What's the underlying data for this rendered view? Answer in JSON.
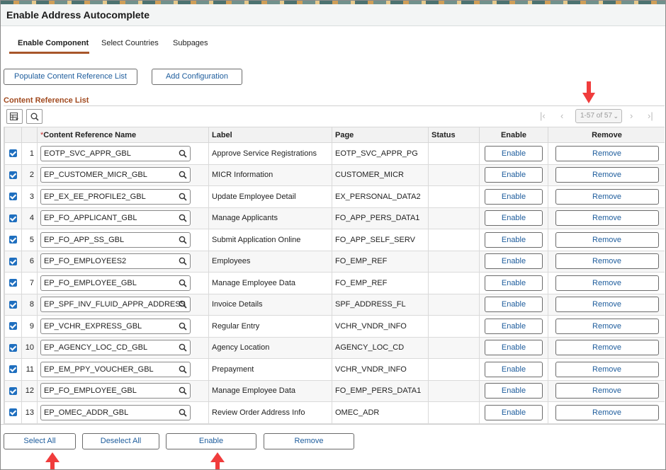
{
  "page": {
    "title": "Enable Address Autocomplete"
  },
  "tabs": [
    {
      "label": "Enable Component",
      "active": true
    },
    {
      "label": "Select Countries",
      "active": false
    },
    {
      "label": "Subpages",
      "active": false
    }
  ],
  "actions": {
    "populate_label": "Populate Content Reference List",
    "add_config_label": "Add Configuration"
  },
  "section": {
    "title": "Content Reference List"
  },
  "toolbar": {
    "grid_icon": "grid-options-icon",
    "search_icon": "search-icon",
    "pager_text": "1-57 of 57"
  },
  "grid": {
    "headers": {
      "name": "Content Reference Name",
      "required_mark": "*",
      "label": "Label",
      "page": "Page",
      "status": "Status",
      "enable": "Enable",
      "remove": "Remove"
    },
    "rows": [
      {
        "num": "1",
        "name": "EOTP_SVC_APPR_GBL",
        "label": "Approve Service Registrations",
        "page": "EOTP_SVC_APPR_PG",
        "status": "",
        "enable": "Enable",
        "remove": "Remove"
      },
      {
        "num": "2",
        "name": "EP_CUSTOMER_MICR_GBL",
        "label": "MICR Information",
        "page": "CUSTOMER_MICR",
        "status": "",
        "enable": "Enable",
        "remove": "Remove"
      },
      {
        "num": "3",
        "name": "EP_EX_EE_PROFILE2_GBL",
        "label": "Update Employee Detail",
        "page": "EX_PERSONAL_DATA2",
        "status": "",
        "enable": "Enable",
        "remove": "Remove"
      },
      {
        "num": "4",
        "name": "EP_FO_APPLICANT_GBL",
        "label": "Manage Applicants",
        "page": "FO_APP_PERS_DATA1",
        "status": "",
        "enable": "Enable",
        "remove": "Remove"
      },
      {
        "num": "5",
        "name": "EP_FO_APP_SS_GBL",
        "label": "Submit Application Online",
        "page": "FO_APP_SELF_SERV",
        "status": "",
        "enable": "Enable",
        "remove": "Remove"
      },
      {
        "num": "6",
        "name": "EP_FO_EMPLOYEES2",
        "label": "Employees",
        "page": "FO_EMP_REF",
        "status": "",
        "enable": "Enable",
        "remove": "Remove"
      },
      {
        "num": "7",
        "name": "EP_FO_EMPLOYEE_GBL",
        "label": "Manage Employee Data",
        "page": "FO_EMP_REF",
        "status": "",
        "enable": "Enable",
        "remove": "Remove"
      },
      {
        "num": "8",
        "name": "EP_SPF_INV_FLUID_APPR_ADDRESS",
        "label": "Invoice Details",
        "page": "SPF_ADDRESS_FL",
        "status": "",
        "enable": "Enable",
        "remove": "Remove"
      },
      {
        "num": "9",
        "name": "EP_VCHR_EXPRESS_GBL",
        "label": "Regular Entry",
        "page": "VCHR_VNDR_INFO",
        "status": "",
        "enable": "Enable",
        "remove": "Remove"
      },
      {
        "num": "10",
        "name": "EP_AGENCY_LOC_CD_GBL",
        "label": "Agency Location",
        "page": "AGENCY_LOC_CD",
        "status": "",
        "enable": "Enable",
        "remove": "Remove"
      },
      {
        "num": "11",
        "name": "EP_EM_PPY_VOUCHER_GBL",
        "label": "Prepayment",
        "page": "VCHR_VNDR_INFO",
        "status": "",
        "enable": "Enable",
        "remove": "Remove"
      },
      {
        "num": "12",
        "name": "EP_FO_EMPLOYEE_GBL",
        "label": "Manage Employee Data",
        "page": "FO_EMP_PERS_DATA1",
        "status": "",
        "enable": "Enable",
        "remove": "Remove"
      },
      {
        "num": "13",
        "name": "EP_OMEC_ADDR_GBL",
        "label": "Review Order Address Info",
        "page": "OMEC_ADR",
        "status": "",
        "enable": "Enable",
        "remove": "Remove"
      }
    ]
  },
  "footer": {
    "select_all": "Select All",
    "deselect_all": "Deselect All",
    "enable": "Enable",
    "remove": "Remove"
  },
  "colors": {
    "accent": "#a8562a",
    "link": "#1d5c9c",
    "checkbox": "#1f6fbf",
    "annotation_arrow": "#f03c3c"
  }
}
